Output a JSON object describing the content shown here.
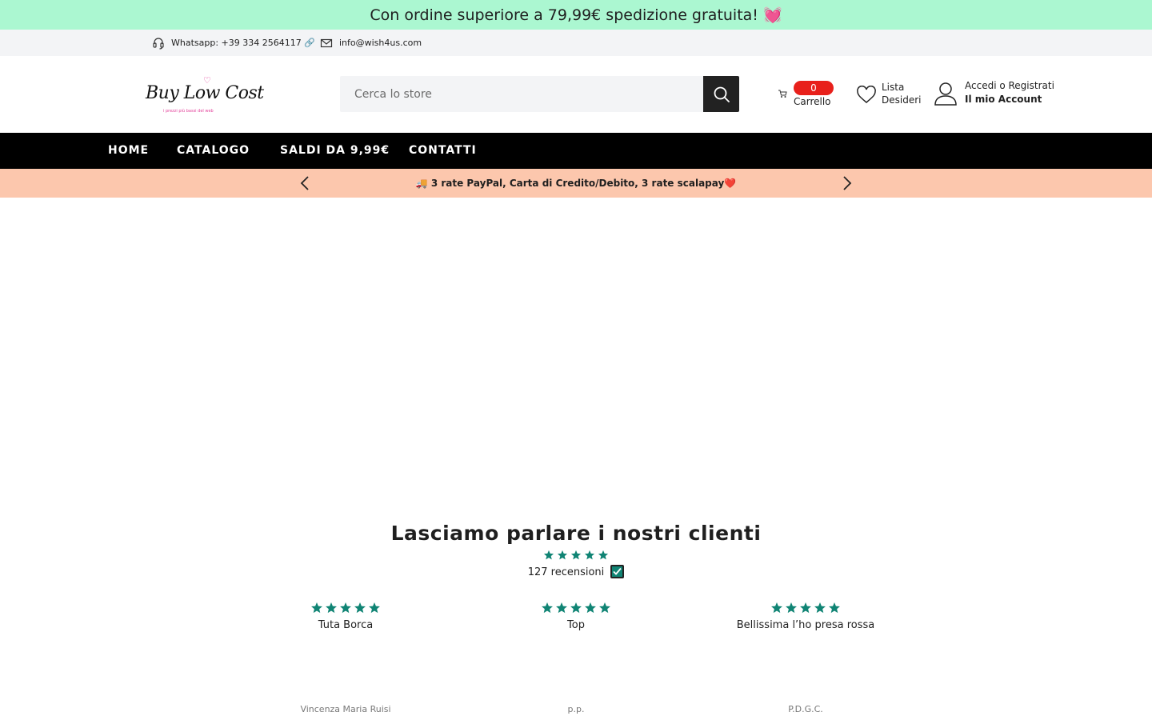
{
  "promo": {
    "text": "Con ordine superiore a 79,99€ spedizione gratuita! 💓"
  },
  "contact": {
    "whatsapp": "Whatsapp: +39 334 2564117 🔗",
    "email": "info@wish4us.com"
  },
  "header": {
    "logo_text": "Buy Low Cost",
    "logo_tagline": "i prezzi più bassi del web",
    "search_placeholder": "Cerca lo store",
    "cart_count": "0",
    "cart_label": "Carrello",
    "wishlist_line1": "Lista",
    "wishlist_line2": "Desideri",
    "account_line1": "Accedi o Registrati",
    "account_line2": "Il mio Account"
  },
  "nav": {
    "items": [
      {
        "label": "HOME"
      },
      {
        "label": "CATALOGO"
      },
      {
        "label": "SALDI DA 9,99€"
      },
      {
        "label": "CONTATTI"
      }
    ]
  },
  "announcement": {
    "text": "🚚 3 rate PayPal, Carta di Credito/Debito, 3 rate scalapay❤️"
  },
  "reviews": {
    "title": "Lasciamo parlare i nostri clienti",
    "rating": 5,
    "count_text": "127 recensioni",
    "items": [
      {
        "rating": 5,
        "title": "Tuta Borca",
        "author": "Vincenza Maria Ruisi"
      },
      {
        "rating": 5,
        "title": "Top",
        "author": "p.p."
      },
      {
        "rating": 5,
        "title": "Bellissima l’ho presa rossa",
        "author": "P.D.G.C."
      }
    ]
  },
  "colors": {
    "promo_bg": "#abf7d1",
    "contact_bg": "#f3f4f6",
    "nav_bg": "#000000",
    "announcement_bg": "#fcc7ad",
    "cart_badge": "#e8201b",
    "star_color": "#108474"
  }
}
